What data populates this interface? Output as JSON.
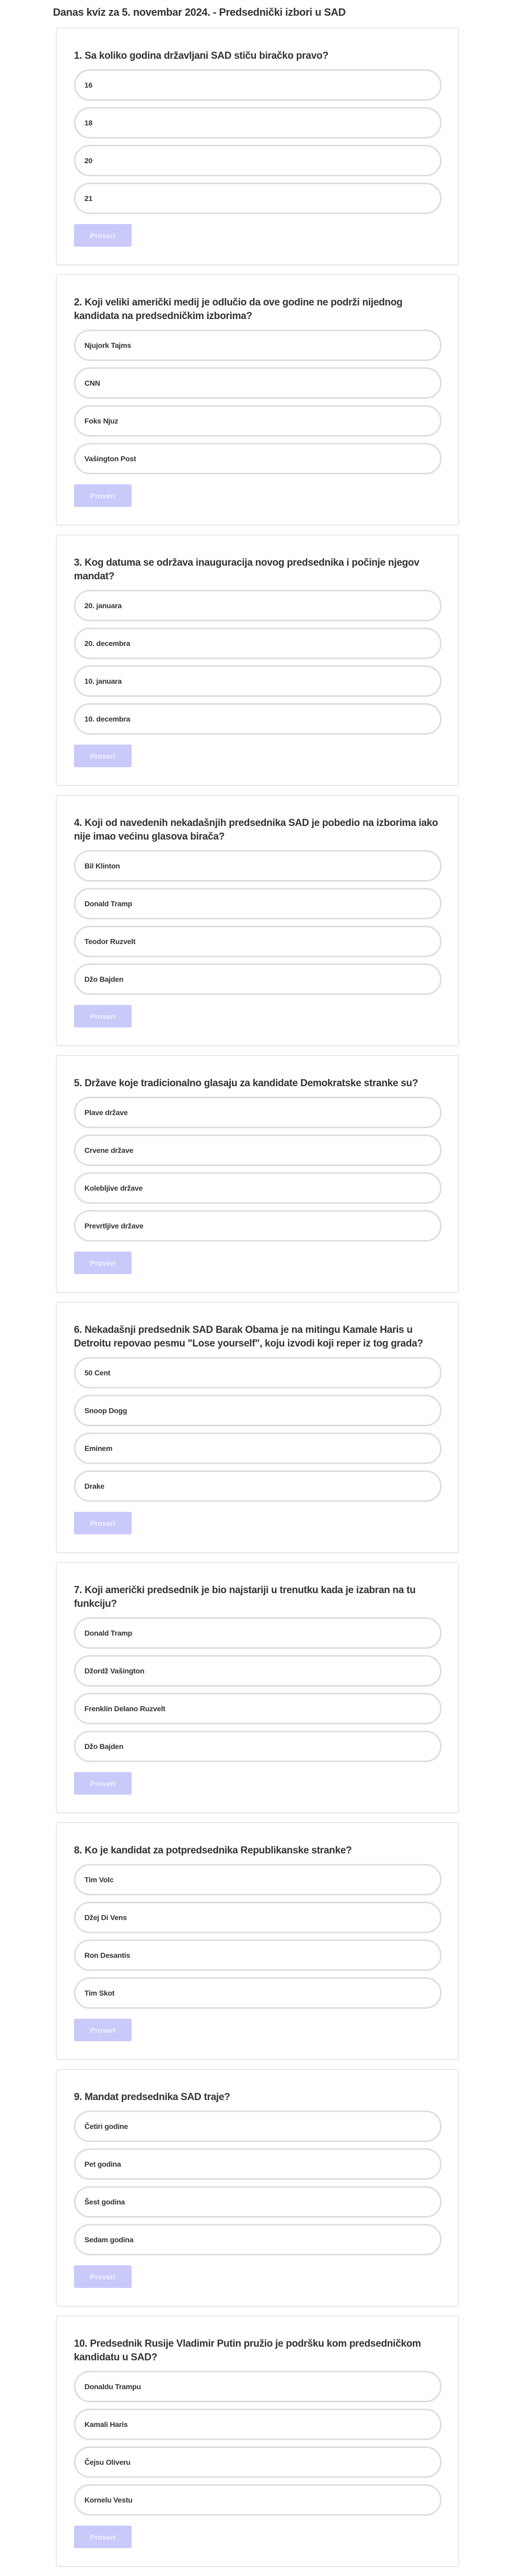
{
  "page": {
    "title": "Danas kviz za 5. novembar 2024. - Predsednički izbori u SAD"
  },
  "colors": {
    "button_disabled": "#c9c9fa",
    "option_border": "#dedede",
    "text": "#333333"
  },
  "check_button_label": "Proveri",
  "questions": [
    {
      "text": "1. Sa koliko godina državljani SAD stiču biračko pravo?",
      "options": [
        "16",
        "18",
        "20",
        "21"
      ]
    },
    {
      "text": "2. Koji veliki američki medij je odlučio da ove godine ne podrži nijednog kandidata na predsedničkim izborima?",
      "options": [
        "Njujork Tajms",
        "CNN",
        "Foks Njuz",
        "Vašington Post"
      ]
    },
    {
      "text": "3. Kog datuma se održava inauguracija novog predsednika i počinje njegov mandat?",
      "options": [
        "20. januara",
        "20. decembra",
        "10. januara",
        "10. decembra"
      ]
    },
    {
      "text": "4. Koji od navedenih nekadašnjih predsednika SAD je pobedio na izborima iako nije imao većinu glasova birača?",
      "options": [
        "Bil Klinton",
        "Donald Tramp",
        "Teodor Ruzvelt",
        "Džo Bajden"
      ]
    },
    {
      "text": "5. Države koje tradicionalno glasaju za kandidate Demokratske stranke su?",
      "options": [
        "Plave države",
        "Crvene države",
        "Kolebljive države",
        "Prevrtljive države"
      ]
    },
    {
      "text": "6. Nekadašnji predsednik SAD Barak Obama je na mitingu Kamale Haris u Detroitu repovao pesmu \"Lose yourself\", koju izvodi koji reper iz tog grada?",
      "options": [
        "50 Cent",
        "Snoop Dogg",
        "Eminem",
        "Drake"
      ]
    },
    {
      "text": "7. Koji američki predsednik je bio najstariji u trenutku kada je izabran na tu funkciju?",
      "options": [
        "Donald Tramp",
        "Džordž Vašington",
        "Frenklin Delano Ruzvelt",
        "Džo Bajden"
      ]
    },
    {
      "text": "8. Ko je kandidat za potpredsednika Republikanske stranke?",
      "options": [
        "Tim Volc",
        "Džej Di Vens",
        "Ron Desantis",
        "Tim Skot"
      ]
    },
    {
      "text": "9. Mandat predsednika SAD traje?",
      "options": [
        "Četiri godine",
        "Pet godina",
        "Šest godina",
        "Sedam godina"
      ]
    },
    {
      "text": "10. Predsednik Rusije Vladimir Putin pružio je podršku kom predsedničkom kandidatu u SAD?",
      "options": [
        "Donaldu Trampu",
        "Kamali Haris",
        "Čejsu Oliveru",
        "Kornelu Vestu"
      ]
    }
  ]
}
